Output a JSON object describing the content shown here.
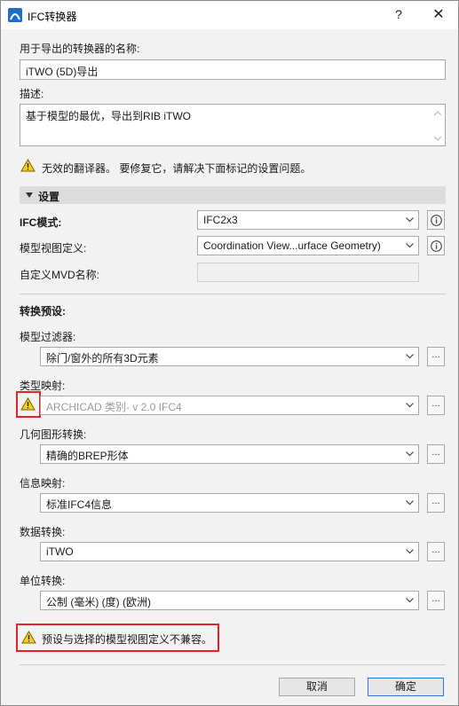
{
  "window": {
    "title": "IFC转换器",
    "help_label": "?",
    "close_label": "✕"
  },
  "name_field": {
    "label": "用于导出的转换器的名称:",
    "value": "iTWO (5D)导出"
  },
  "description": {
    "label": "描述:",
    "value": "基于模型的最优，导出到RIB iTWO"
  },
  "warning_top": "无效的翻译器。 要修复它，请解决下面标记的设置问题。",
  "settings_section": {
    "title": "设置"
  },
  "ifc_mode": {
    "label": "IFC模式:",
    "value": "IFC2x3"
  },
  "mvd": {
    "label": "模型视图定义:",
    "value": "Coordination View...urface Geometry)"
  },
  "custom_mvd": {
    "label": "自定义MVD名称:",
    "value": ""
  },
  "presets": {
    "title": "转换预设:",
    "items": [
      {
        "label": "模型过滤器:",
        "value": "除门/窗外的所有3D元素",
        "disabled": false
      },
      {
        "label": "类型映射:",
        "value": "ARCHICAD 类别- v 2.0 IFC4",
        "disabled": true
      },
      {
        "label": "几何图形转换:",
        "value": "精确的BREP形体",
        "disabled": false
      },
      {
        "label": "信息映射:",
        "value": "标准IFC4信息",
        "disabled": false
      },
      {
        "label": "数据转换:",
        "value": "iTWO",
        "disabled": false
      },
      {
        "label": "单位转换:",
        "value": "公制 (毫米) (度) (欧洲)",
        "disabled": false
      }
    ],
    "more_label": "..."
  },
  "warning_bottom": "预设与选择的模型视图定义不兼容。",
  "buttons": {
    "cancel": "取消",
    "ok": "确定"
  },
  "colors": {
    "highlight_red": "#e0242a",
    "warning_yellow": "#f7d117",
    "primary_blue": "#2b78d6"
  }
}
